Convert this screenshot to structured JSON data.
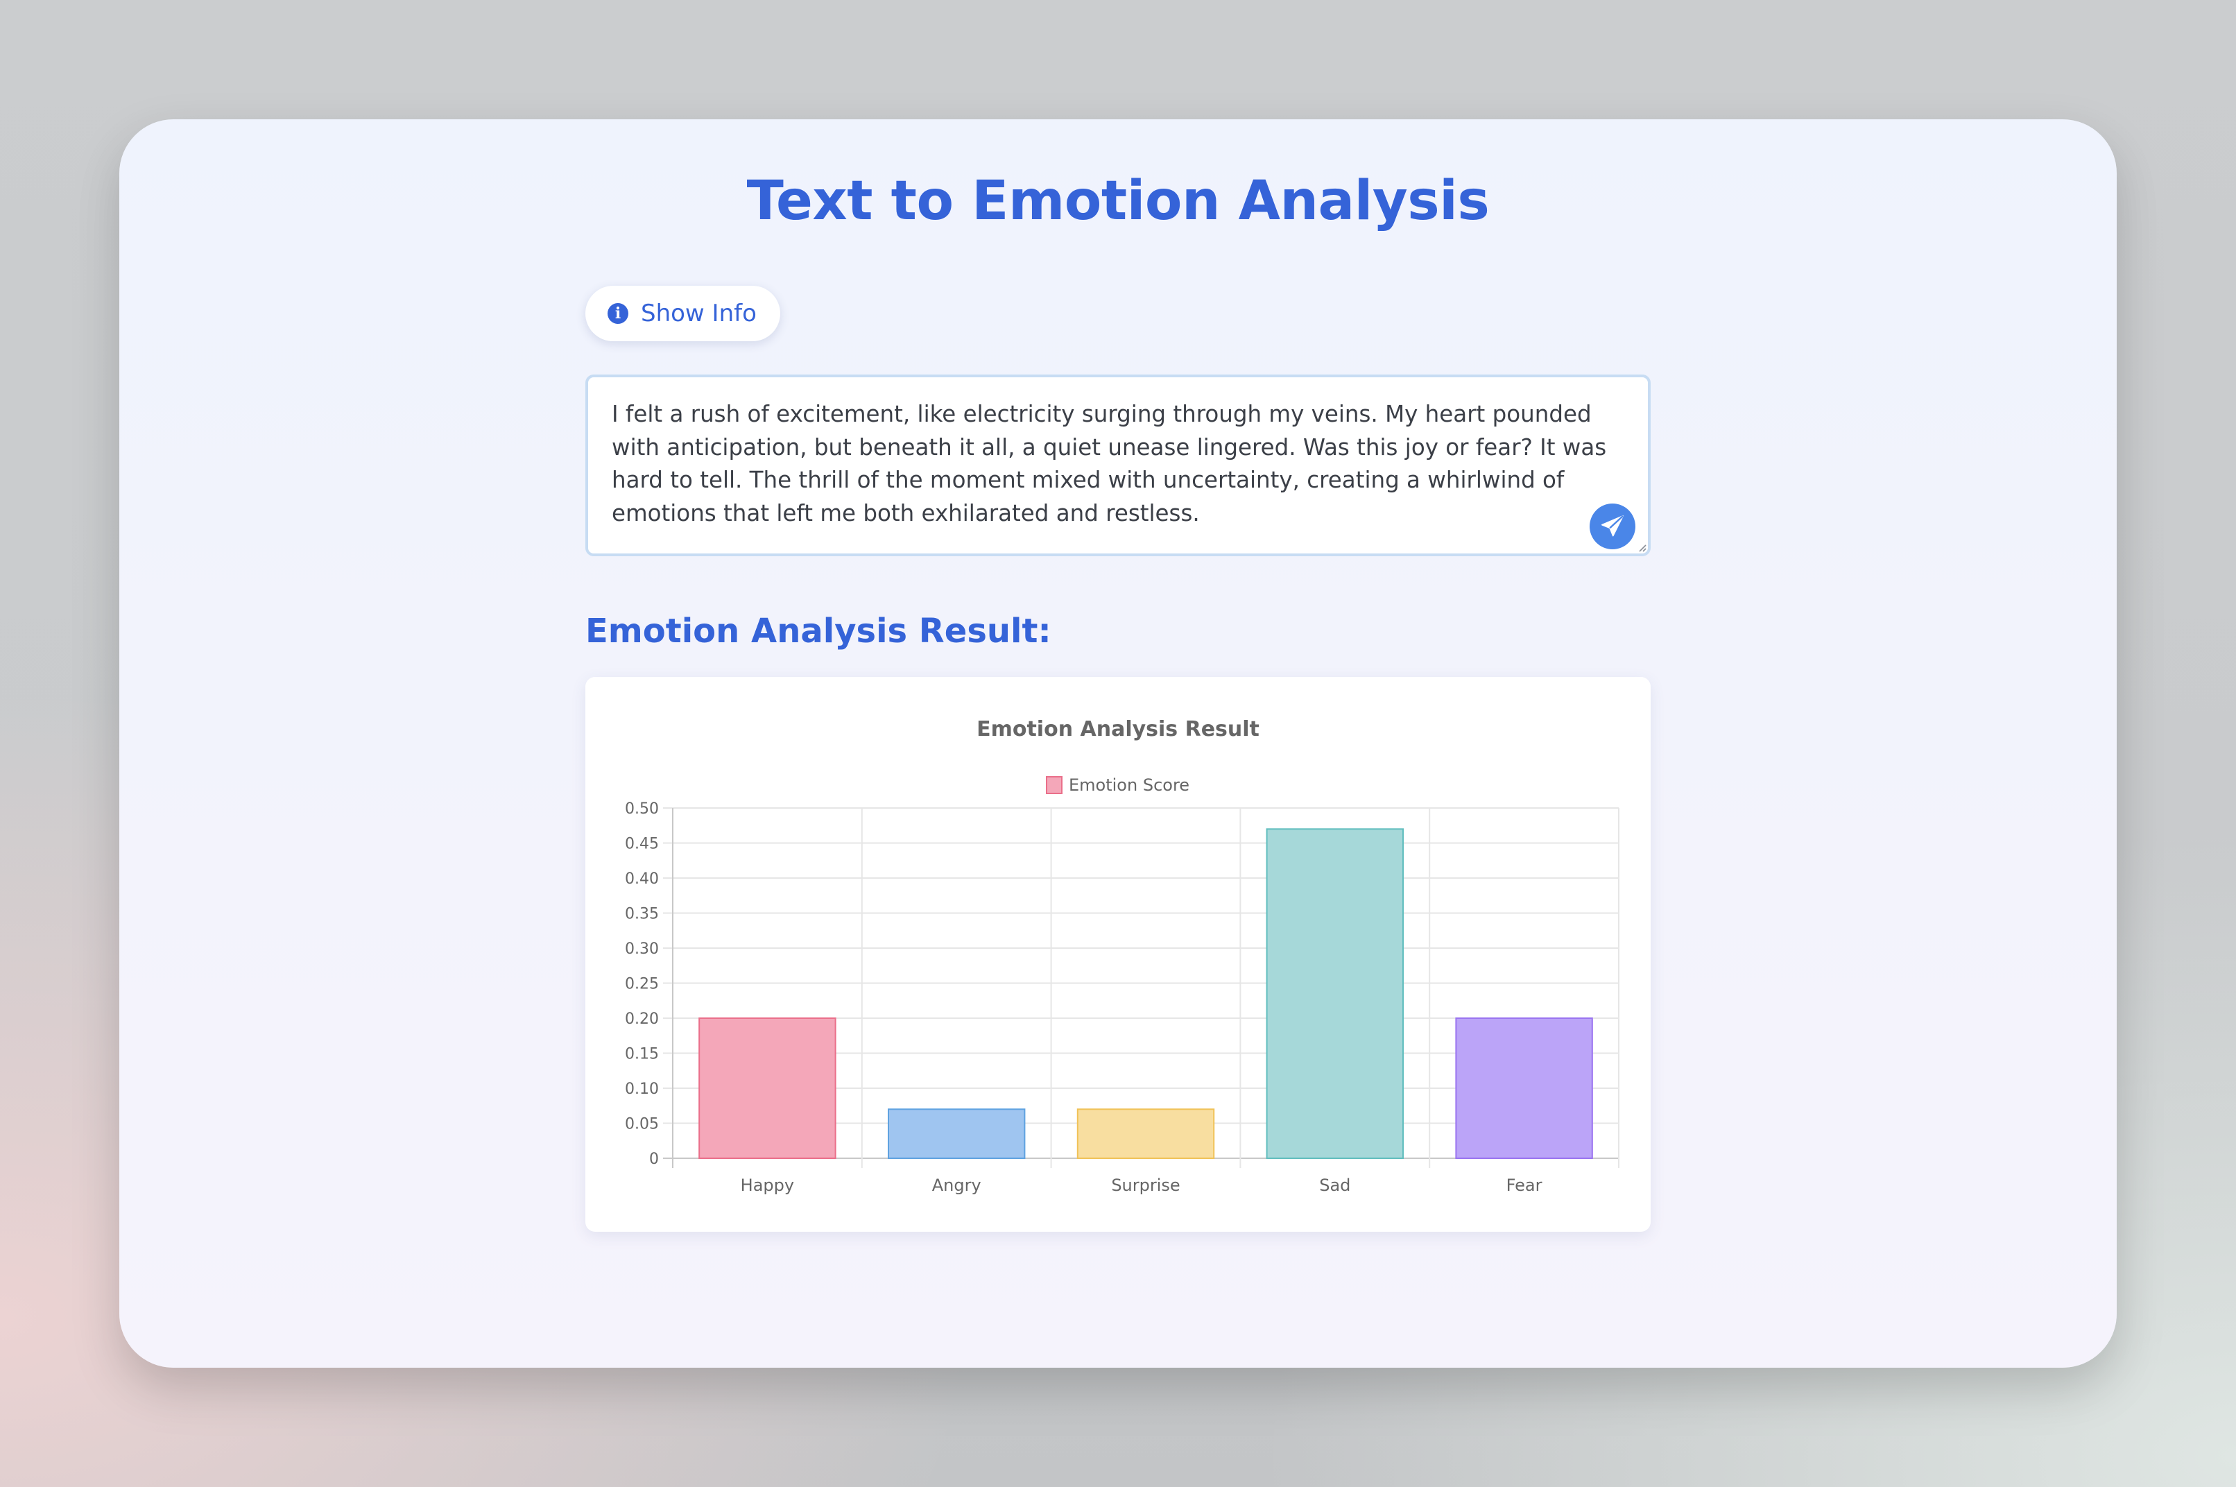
{
  "page": {
    "title": "Text to Emotion Analysis",
    "info_button_label": "Show Info",
    "input_text": "I felt a rush of excitement, like electricity surging through my veins. My heart pounded with anticipation, but beneath it all, a quiet unease lingered. Was this joy or fear? It was hard to tell. The thrill of the moment mixed with uncertainty, creating a whirlwind of emotions that left me both exhilarated and restless.",
    "result_heading": "Emotion Analysis Result:"
  },
  "icons": {
    "info": "info-circle-icon",
    "send": "paper-plane-icon"
  },
  "colors": {
    "accent": "#3563d8",
    "send_button": "#4a86e8"
  },
  "chart_data": {
    "type": "bar",
    "title": "Emotion Analysis Result",
    "categories": [
      "Happy",
      "Angry",
      "Surprise",
      "Sad",
      "Fear"
    ],
    "series": [
      {
        "name": "Emotion Score",
        "values": [
          0.2,
          0.07,
          0.07,
          0.47,
          0.2
        ]
      }
    ],
    "bar_colors": [
      "#f4a7b9",
      "#9fc5f0",
      "#f8dea0",
      "#a6d8d9",
      "#bba4f8"
    ],
    "bar_borders": [
      "#ea6f8a",
      "#5fa2e0",
      "#f0c258",
      "#61bebe",
      "#9a74f0"
    ],
    "yticks": [
      "0",
      "0.05",
      "0.10",
      "0.15",
      "0.20",
      "0.25",
      "0.30",
      "0.35",
      "0.40",
      "0.45",
      "0.50"
    ],
    "ylim": [
      0,
      0.5
    ],
    "grid": true,
    "legend_position": "top"
  }
}
